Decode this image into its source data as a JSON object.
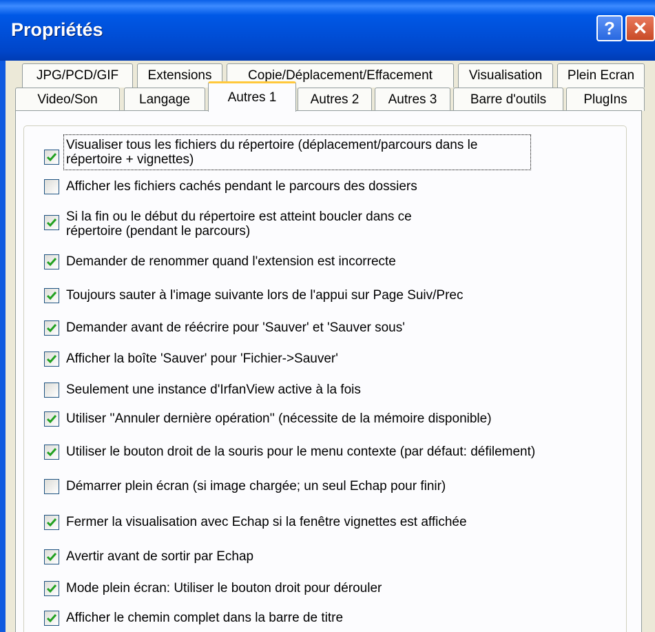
{
  "window": {
    "title": "Propriétés",
    "help_label": "?",
    "close_label": "✕"
  },
  "tabs_row1": [
    "JPG/PCD/GIF",
    "Extensions",
    "Copie/Déplacement/Effacement",
    "Visualisation",
    "Plein Ecran"
  ],
  "tabs_row2": [
    "Video/Son",
    "Langage",
    "Autres 1",
    "Autres 2",
    "Autres 3",
    "Barre d'outils",
    "PlugIns"
  ],
  "active_tab": "Autres 1",
  "options": [
    {
      "line1": "Visualiser tous les fichiers du répertoire (déplacement/parcours dans le",
      "line2": "répertoire + vignettes)",
      "checked": true
    },
    {
      "line1": "Afficher les fichiers cachés pendant le parcours des dossiers",
      "checked": false
    },
    {
      "line1": "Si la fin ou le début du répertoire est atteint boucler dans ce",
      "line2": "répertoire (pendant le parcours)",
      "checked": true
    },
    {
      "line1": "Demander de renommer quand l'extension est incorrecte",
      "checked": true
    },
    {
      "line1": "Toujours sauter à l'image suivante lors de l'appui sur Page Suiv/Prec",
      "checked": true
    },
    {
      "line1": "Demander avant de réécrire pour  'Sauver' et 'Sauver sous'",
      "checked": true
    },
    {
      "line1": "Afficher la boîte 'Sauver' pour 'Fichier->Sauver'",
      "checked": true
    },
    {
      "line1": "Seulement une instance d'IrfanView active à la fois",
      "checked": false
    },
    {
      "line1": "Utiliser ''Annuler dernière opération'' (nécessite de la mémoire disponible)",
      "checked": true
    },
    {
      "line1": "Utiliser le bouton droit de la souris pour le menu contexte (par défaut: défilement)",
      "checked": true
    },
    {
      "line1": "Démarrer plein écran (si image chargée; un seul Echap pour finir)",
      "checked": false
    },
    {
      "line1": "Fermer la visualisation avec Echap si la fenêtre vignettes est affichée",
      "checked": true
    },
    {
      "line1": "Avertir avant de sortir par Echap",
      "checked": true
    },
    {
      "line1": "Mode plein écran: Utiliser le bouton droit pour dérouler",
      "checked": true
    },
    {
      "line1": "Afficher le chemin complet dans la barre de titre",
      "checked": true
    }
  ],
  "colors": {
    "titlebar": "#0054e3",
    "dialog_bg": "#ece9d8",
    "check_green": "#21a121",
    "checkbox_border": "#1c5180",
    "active_tab_accent": "#ffc83c"
  }
}
